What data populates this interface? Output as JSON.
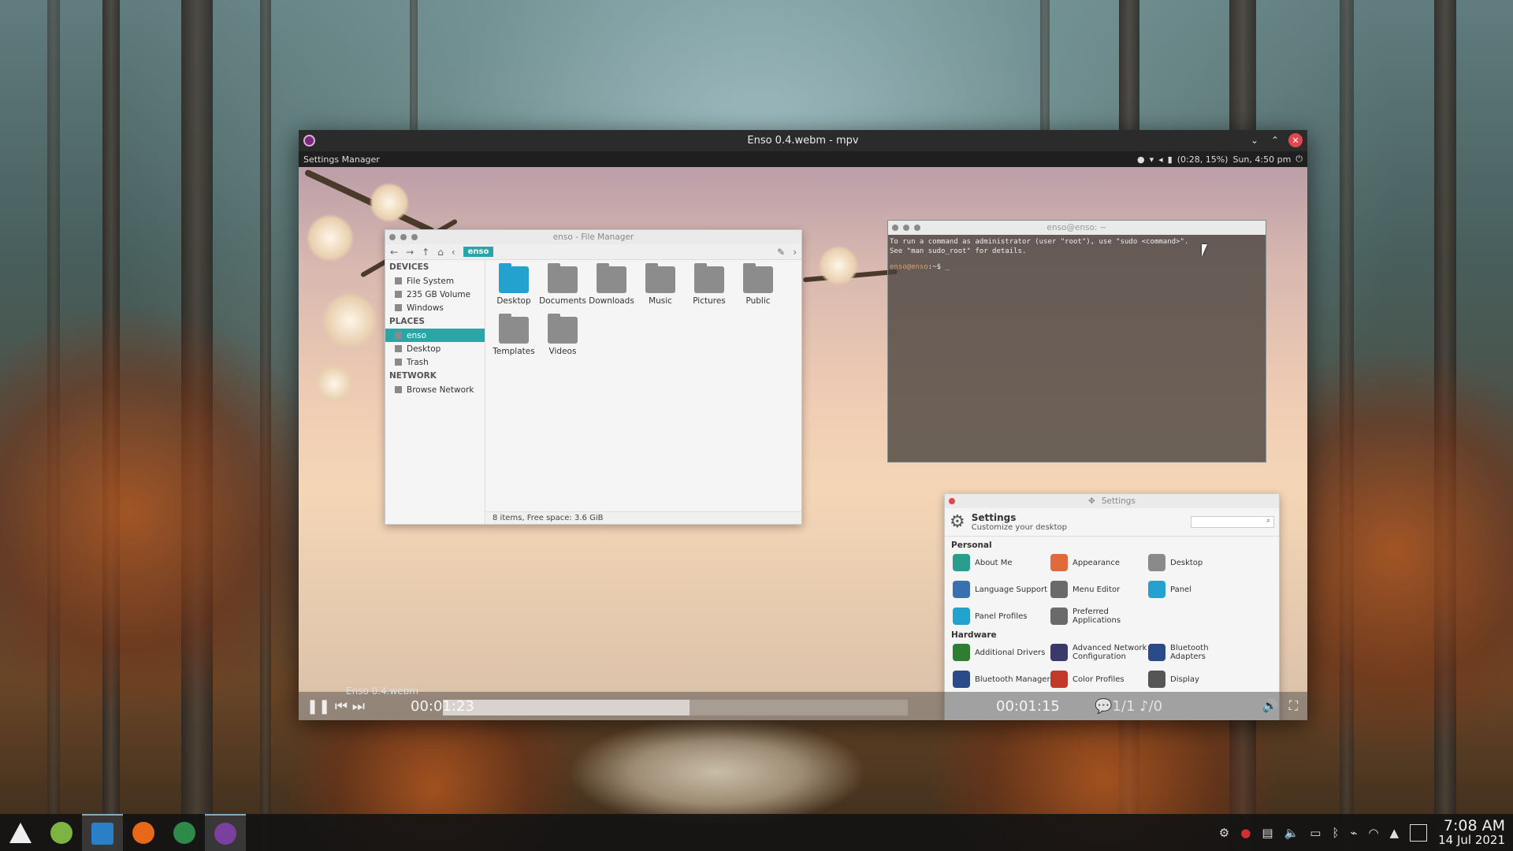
{
  "mpv": {
    "title": "Enso 0.4.webm - mpv",
    "inner_panel": {
      "left_label": "Settings Manager",
      "battery": "(0:28, 15%)",
      "datetime": "Sun, 4:50 pm"
    },
    "osc": {
      "filename": "Enso 0.4.webm",
      "elapsed": "00:01:23",
      "remaining": "00:01:15",
      "sub_track": "1/1",
      "audio_track": "/0",
      "progress_fraction": 0.53
    }
  },
  "file_manager": {
    "title": "enso - File Manager",
    "breadcrumb": "enso",
    "sections": [
      {
        "label": "DEVICES",
        "items": [
          "File System",
          "235 GB Volume",
          "Windows"
        ]
      },
      {
        "label": "PLACES",
        "items": [
          "enso",
          "Desktop",
          "Trash"
        ]
      },
      {
        "label": "NETWORK",
        "items": [
          "Browse Network"
        ]
      }
    ],
    "selected_place": "enso",
    "folders": [
      "Desktop",
      "Documents",
      "Downloads",
      "Music",
      "Pictures",
      "Public",
      "Templates",
      "Videos"
    ],
    "status": "8 items, Free space: 3.6 GiB"
  },
  "terminal": {
    "title": "enso@enso: ~",
    "line1": "To run a command as administrator (user \"root\"), use \"sudo <command>\".",
    "line2": "See \"man sudo_root\" for details.",
    "prompt": "enso@enso",
    "prompt_suffix": ":~$ _"
  },
  "settings": {
    "title": "Settings",
    "heading": "Settings",
    "subheading": "Customize your desktop",
    "categories": [
      {
        "label": "Personal",
        "items": [
          {
            "label": "About Me",
            "icon": "user-icon",
            "color": "#2a9d8f"
          },
          {
            "label": "Appearance",
            "icon": "palette-icon",
            "color": "#e06a3a"
          },
          {
            "label": "Desktop",
            "icon": "desktop-icon",
            "color": "#8a8a8a"
          },
          {
            "label": "Language Support",
            "icon": "language-icon",
            "color": "#3a6fb0"
          },
          {
            "label": "Menu Editor",
            "icon": "menu-editor-icon",
            "color": "#6a6a6a"
          },
          {
            "label": "Panel",
            "icon": "panel-icon",
            "color": "#23a2cf"
          },
          {
            "label": "Panel Profiles",
            "icon": "panel-profiles-icon",
            "color": "#23a2cf"
          },
          {
            "label": "Preferred Applications",
            "icon": "star-icon",
            "color": "#6a6a6a"
          }
        ]
      },
      {
        "label": "Hardware",
        "items": [
          {
            "label": "Additional Drivers",
            "icon": "chip-icon",
            "color": "#2e7d32"
          },
          {
            "label": "Advanced Network Configuration",
            "icon": "network-icon",
            "color": "#3a3a6a"
          },
          {
            "label": "Bluetooth Adapters",
            "icon": "bluetooth-icon",
            "color": "#2b4a8a"
          },
          {
            "label": "Bluetooth Manager",
            "icon": "bluetooth-icon",
            "color": "#2b4a8a"
          },
          {
            "label": "Color Profiles",
            "icon": "color-icon",
            "color": "#c0392b"
          },
          {
            "label": "Display",
            "icon": "display-icon",
            "color": "#555555"
          }
        ]
      }
    ]
  },
  "taskbar": {
    "apps": [
      {
        "name": "enso-menu-icon",
        "color": "#eeeeee"
      },
      {
        "name": "download-icon",
        "color": "#7cb342"
      },
      {
        "name": "file-manager-icon",
        "color": "#2b7fc6"
      },
      {
        "name": "firefox-icon",
        "color": "#e8681a"
      },
      {
        "name": "chrome-icon",
        "color": "#2f8a4a"
      },
      {
        "name": "mpv-icon",
        "color": "#7b3f9e"
      }
    ],
    "clock_time": "7:08 AM",
    "clock_date": "14 Jul 2021"
  }
}
